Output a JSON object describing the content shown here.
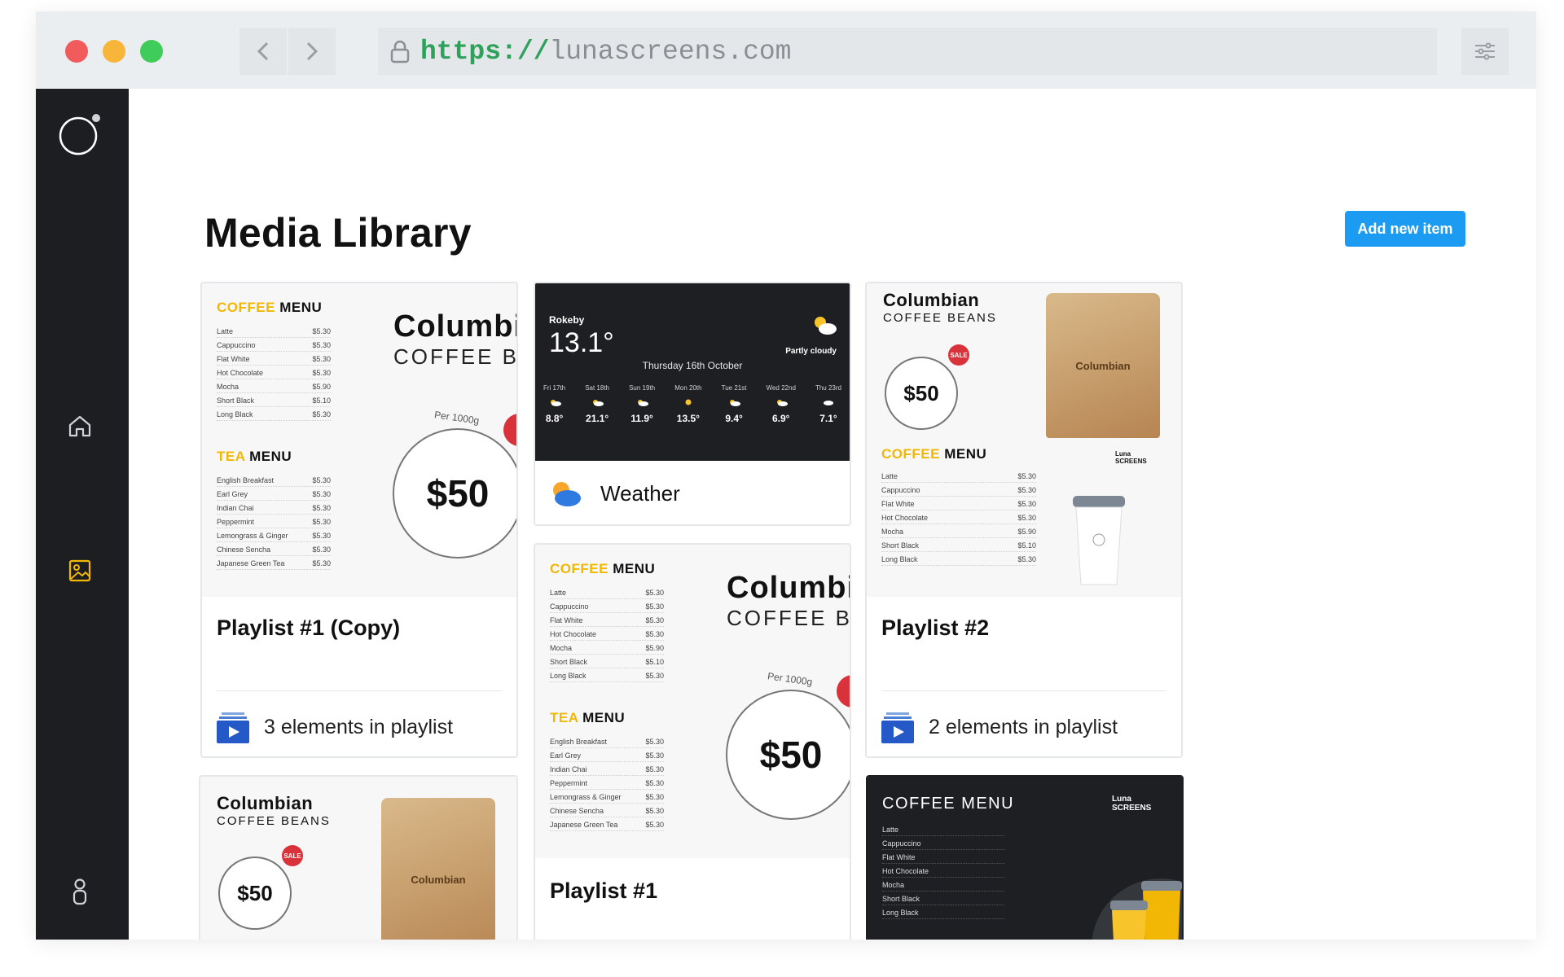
{
  "browser": {
    "url_scheme": "https://",
    "url_host": "lunascreens.com",
    "traffic_lights": {
      "close": "#f15b5b",
      "minimize": "#f7b63a",
      "maximize": "#3fcc5a"
    }
  },
  "sidebar": {
    "items": [
      {
        "name": "home",
        "icon": "home-icon",
        "active": false
      },
      {
        "name": "media",
        "icon": "image-icon",
        "active": true
      },
      {
        "name": "account",
        "icon": "user-icon",
        "active": false
      }
    ],
    "active_color": "#f2b705"
  },
  "page": {
    "title": "Media Library",
    "add_button": "Add new item",
    "accent": "#1b9cf2"
  },
  "cards": [
    {
      "title": "Playlist #1 (Copy)",
      "footer": "3 elements in playlist"
    },
    {
      "title": "Weather"
    },
    {
      "title": "Playlist #2",
      "footer": "2 elements in playlist"
    },
    {
      "title": "Playlist #1"
    }
  ],
  "coffee_menu": {
    "heading_a": "COFFEE",
    "heading_b": "MENU",
    "items": [
      {
        "name": "Latte",
        "price": "$5.30"
      },
      {
        "name": "Cappuccino",
        "price": "$5.30"
      },
      {
        "name": "Flat White",
        "price": "$5.30"
      },
      {
        "name": "Hot Chocolate",
        "price": "$5.30"
      },
      {
        "name": "Mocha",
        "price": "$5.90"
      },
      {
        "name": "Short Black",
        "price": "$5.10"
      },
      {
        "name": "Long Black",
        "price": "$5.30"
      }
    ]
  },
  "tea_menu": {
    "heading_a": "TEA",
    "heading_b": "MENU",
    "items": [
      {
        "name": "English Breakfast",
        "price": "$5.30"
      },
      {
        "name": "Earl Grey",
        "price": "$5.30"
      },
      {
        "name": "Indian Chai",
        "price": "$5.30"
      },
      {
        "name": "Peppermint",
        "price": "$5.30"
      },
      {
        "name": "Lemongrass & Ginger",
        "price": "$5.30"
      },
      {
        "name": "Chinese Sencha",
        "price": "$5.30"
      },
      {
        "name": "Japanese Green Tea",
        "price": "$5.30"
      }
    ]
  },
  "promo": {
    "brand": "Columbian",
    "sub": "COFFEE BEANS",
    "per": "Per 1000g",
    "price": "$50",
    "sale": "SALE",
    "bag_label": "Columbian",
    "bag_weight": "1000g",
    "luna_label": "Luna SCREENS"
  },
  "weather": {
    "city": "Rokeby",
    "temp": "13.1°",
    "condition": "Partly cloudy",
    "date": "Thursday 16th October",
    "days": [
      {
        "day": "Fri 17th",
        "temp": "8.8°"
      },
      {
        "day": "Sat 18th",
        "temp": "21.1°"
      },
      {
        "day": "Sun 19th",
        "temp": "11.9°"
      },
      {
        "day": "Mon 20th",
        "temp": "13.5°"
      },
      {
        "day": "Tue 21st",
        "temp": "9.4°"
      },
      {
        "day": "Wed 22nd",
        "temp": "6.9°"
      },
      {
        "day": "Thu 23rd",
        "temp": "7.1°"
      }
    ]
  },
  "dark_menu": {
    "heading": "COFFEE MENU",
    "luna": "Luna SCREENS",
    "items": [
      "Latte",
      "Cappuccino",
      "Flat White",
      "Hot Chocolate",
      "Mocha",
      "Short Black",
      "Long Black"
    ]
  }
}
